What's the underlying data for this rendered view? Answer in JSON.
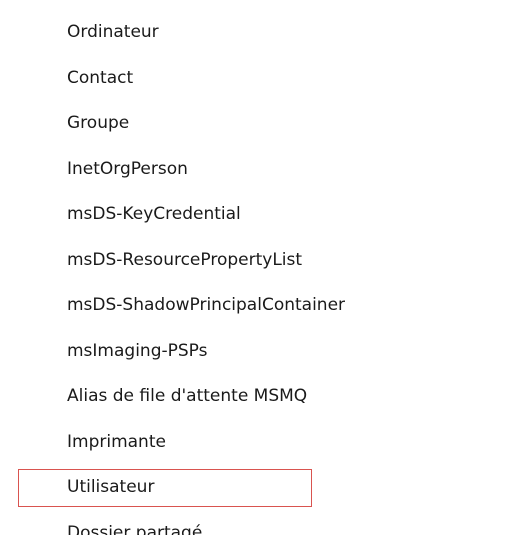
{
  "context_menu": {
    "items": [
      {
        "label": "Ordinateur"
      },
      {
        "label": "Contact"
      },
      {
        "label": "Groupe"
      },
      {
        "label": "InetOrgPerson"
      },
      {
        "label": "msDS-KeyCredential"
      },
      {
        "label": "msDS-ResourcePropertyList"
      },
      {
        "label": "msDS-ShadowPrincipalContainer"
      },
      {
        "label": "msImaging-PSPs"
      },
      {
        "label": "Alias de file d'attente MSMQ"
      },
      {
        "label": "Imprimante"
      },
      {
        "label": "Utilisateur",
        "highlighted": true,
        "highlight_color": "#d9534f"
      },
      {
        "label": "Dossier partagé"
      }
    ]
  }
}
